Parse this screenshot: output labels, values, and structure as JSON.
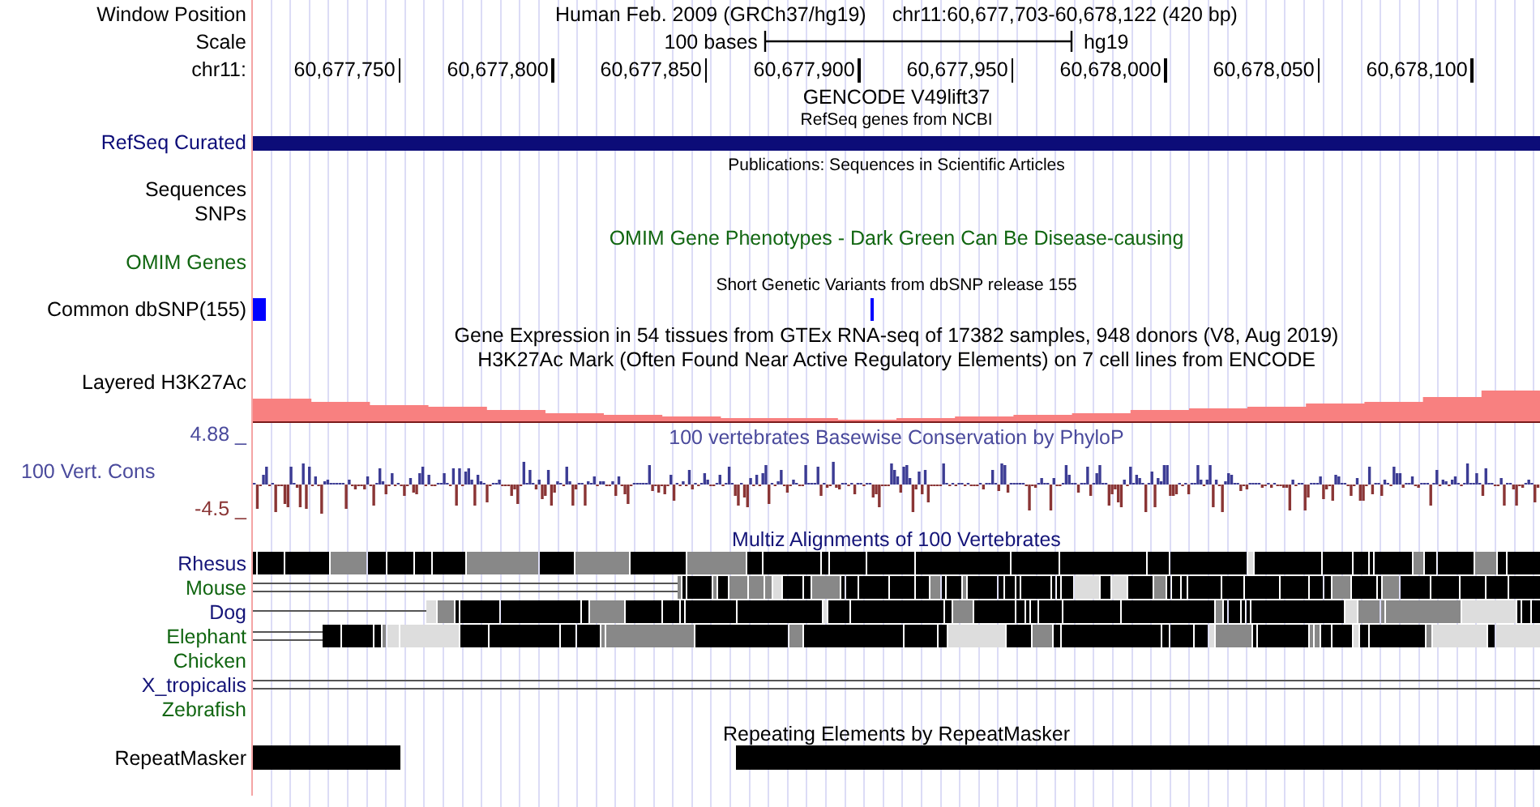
{
  "tracks": [
    {
      "kind": "header",
      "label": "Window Position",
      "title": "Human Feb. 2009 (GRCh37/hg19)",
      "position": "chr11:60,677,703-60,678,122 (420 bp)"
    },
    {
      "kind": "scale",
      "label": "Scale",
      "scale_text": "100 bases",
      "assembly": "hg19"
    },
    {
      "kind": "ruler",
      "label": "chr11:",
      "ticks": [
        "60,677,750",
        "60,677,800",
        "60,677,850",
        "60,677,900",
        "60,677,950",
        "60,678,000",
        "60,678,050",
        "60,678,100"
      ]
    },
    {
      "kind": "title",
      "title": "GENCODE V49lift37"
    },
    {
      "kind": "small_title",
      "title": "RefSeq genes from NCBI"
    },
    {
      "kind": "gene",
      "label": "RefSeq Curated",
      "color": "#0c0c78"
    },
    {
      "kind": "small_title",
      "title": "Publications: Sequences in Scientific Articles"
    },
    {
      "kind": "label",
      "label": "Sequences"
    },
    {
      "kind": "label",
      "label": "SNPs"
    },
    {
      "kind": "title",
      "title": "OMIM Gene Phenotypes - Dark Green Can Be Disease-causing",
      "color": "#116611"
    },
    {
      "kind": "label",
      "label": "OMIM Genes",
      "color": "#116611"
    },
    {
      "kind": "small_title",
      "title": "Short Genetic Variants from dbSNP release 155"
    },
    {
      "kind": "snp",
      "label": "Common dbSNP(155)"
    },
    {
      "kind": "title",
      "title": "Gene Expression in 54 tissues from GTEx RNA-seq of 17382 samples, 948 donors (V8, Aug 2019)"
    },
    {
      "kind": "title",
      "title": "H3K27Ac Mark (Often Found Near Active Regulatory Elements) on 7 cell lines from ENCODE"
    },
    {
      "kind": "signal",
      "label": "Layered H3K27Ac"
    },
    {
      "kind": "conservation",
      "label": "100 Vert. Cons",
      "max_label": "4.88 _",
      "min_label": "-4.5 _",
      "title": "100 vertebrates Basewise Conservation by PhyloP",
      "color": "#4a4a9c"
    },
    {
      "kind": "title",
      "title": "Multiz Alignments of 100 Vertebrates",
      "color": "#141478"
    },
    {
      "kind": "alignment",
      "label": "Rhesus",
      "color": "#141478"
    },
    {
      "kind": "alignment",
      "label": "Mouse",
      "color": "#116611"
    },
    {
      "kind": "alignment",
      "label": "Dog",
      "color": "#141478"
    },
    {
      "kind": "alignment",
      "label": "Elephant",
      "color": "#116611"
    },
    {
      "kind": "alignment",
      "label": "Chicken",
      "color": "#116611"
    },
    {
      "kind": "alignment",
      "label": "X_tropicalis",
      "color": "#141478"
    },
    {
      "kind": "alignment",
      "label": "Zebrafish",
      "color": "#116611"
    },
    {
      "kind": "title",
      "title": "Repeating Elements by RepeatMasker"
    },
    {
      "kind": "repeat",
      "label": "RepeatMasker"
    }
  ]
}
